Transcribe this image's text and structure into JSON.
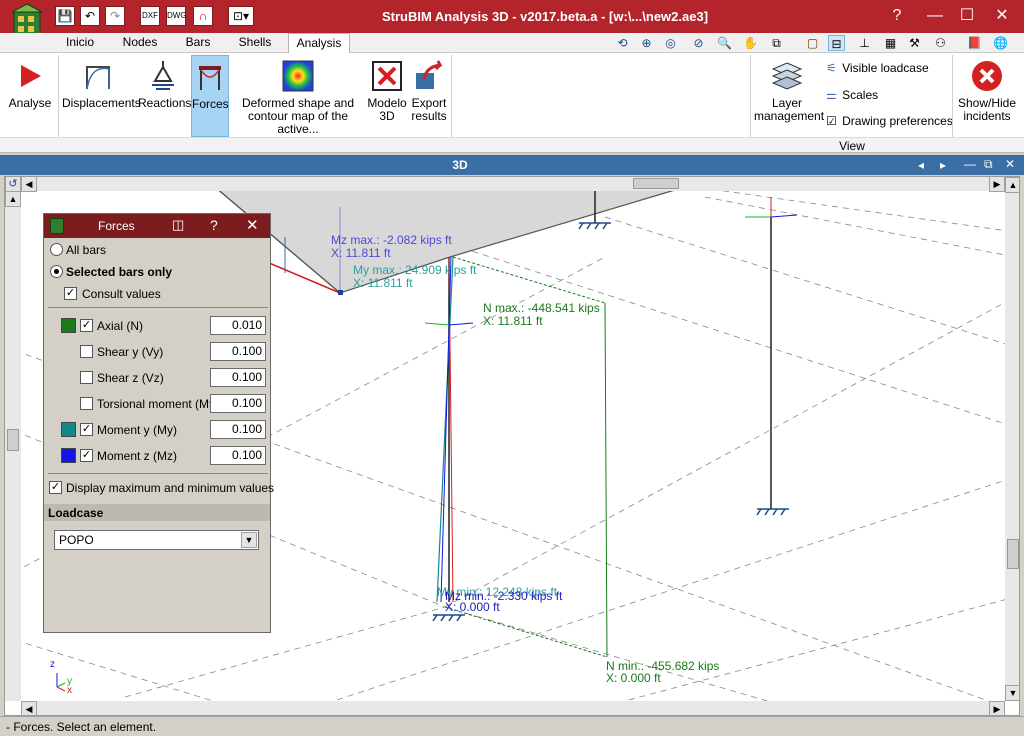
{
  "window": {
    "title": "StruBIM Analysis 3D - v2017.beta.a - [w:\\...\\new2.ae3]",
    "help": "?",
    "min": "—",
    "max": "☐",
    "close": "✕"
  },
  "menu": {
    "tabs": [
      {
        "label": "Inicio"
      },
      {
        "label": "Nodes"
      },
      {
        "label": "Bars"
      },
      {
        "label": "Shells"
      },
      {
        "label": "Analysis"
      }
    ]
  },
  "ribbon": {
    "analyse": "Analyse",
    "displacements": "Displacements",
    "reactions": "Reactions",
    "forces": "Forces",
    "deformed_line1": "Deformed shape and",
    "deformed_line2": "contour map of the active...",
    "modelo_line1": "Modelo",
    "modelo_line2": "3D",
    "export_line1": "Export",
    "export_line2": "results",
    "layer_line1": "Layer",
    "layer_line2": "management",
    "visible_loadcase": "Visible loadcase",
    "scales": "Scales",
    "drawing_preferences": "Drawing preferences",
    "show_hide_line1": "Show/Hide",
    "show_hide_line2": "incidents",
    "view_group": "View"
  },
  "view": {
    "title": "3D",
    "labels": {
      "mz_max": "Mz max.: -2.082 kips ft",
      "mz_max_x": "X: 11.811 ft",
      "my_max": "My max.: 24.909 kips ft",
      "my_max_x": "X: 11.811 ft",
      "n_max": "N max.: -448.541 kips",
      "n_max_x": "X: 11.811 ft",
      "my_min": "My min.: 12.248 kips ft",
      "mz_min": "Mz min.: -2.330 kips ft",
      "min_x": "X: 0.000 ft",
      "n_min": "N min.: -455.682 kips",
      "n_min_x": "X: 0.000 ft"
    },
    "axis_z": "z",
    "axis_y": "y",
    "axis_x": "x"
  },
  "forces_panel": {
    "title": "Forces",
    "all_bars": "All bars",
    "selected_bars_only": "Selected bars only",
    "consult_values": "Consult values",
    "rows": [
      {
        "label": "Axial (N)",
        "value": "0.010",
        "checked": "✓",
        "color": "#1a7a1a"
      },
      {
        "label": "Shear y (Vy)",
        "value": "0.100",
        "checked": ""
      },
      {
        "label": "Shear z (Vz)",
        "value": "0.100",
        "checked": ""
      },
      {
        "label": "Torsional moment (Mt)",
        "value": "0.100",
        "checked": ""
      },
      {
        "label": "Moment y (My)",
        "value": "0.100",
        "checked": "✓",
        "color": "#138a8a"
      },
      {
        "label": "Moment z (Mz)",
        "value": "0.100",
        "checked": "✓",
        "color": "#1414e6"
      }
    ],
    "display_maxmin": "Display maximum and minimum values",
    "display_maxmin_check": "✓",
    "consult_check": "✓",
    "loadcase_header": "Loadcase",
    "loadcase_value": "POPO"
  },
  "status": {
    "text": "- Forces.  Select an element."
  }
}
